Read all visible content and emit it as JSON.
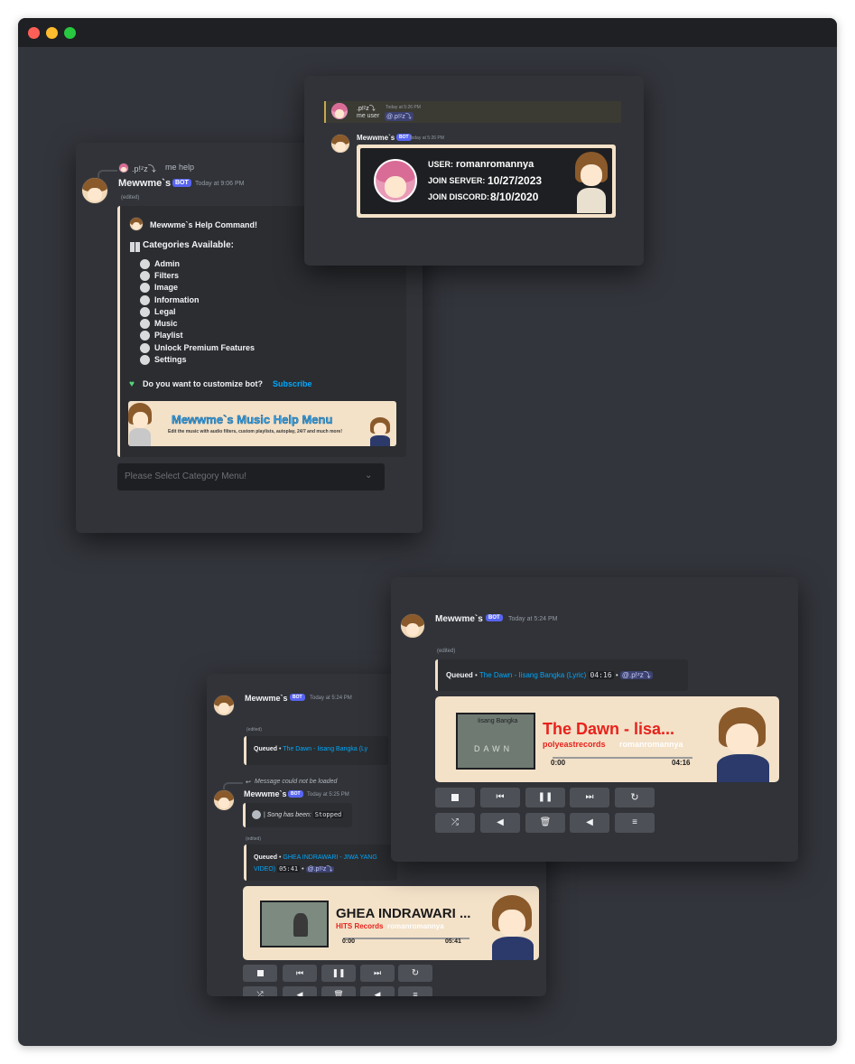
{
  "help_card": {
    "reply": {
      "user": ".p!ᶻz⤵",
      "command": "me help"
    },
    "bot_name": "Mewwme`s",
    "bot_badge": "BOT",
    "timestamp": "Today at 9:06 PM",
    "edited": "(edited)",
    "embed_title": "Mewwme`s Help Command!",
    "categories_heading": "Categories Available:",
    "categories": [
      "Admin",
      "Filters",
      "Image",
      "Information",
      "Legal",
      "Music",
      "Playlist",
      "Unlock Premium Features",
      "Settings"
    ],
    "customize_text": "Do you want to customize bot?",
    "subscribe_link": "Subscribe",
    "banner_title": "Mewwme`s Music Help Menu",
    "banner_subtitle": "Edit the music with audio filters, custom playlists, autoplay, 24/7 and much more!",
    "select_placeholder": "Please Select Category Menu!"
  },
  "user_card": {
    "reply_user": ".p!ᶻz⤵",
    "reply_time": "Today at 5:26 PM",
    "reply_command": "me user",
    "reply_mention": "@.p!ᶻz⤵",
    "bot_name": "Mewwme`s",
    "bot_badge": "BOT",
    "timestamp": "Today at 5:26 PM",
    "user_label": "USER:",
    "user_value": "romanromannya",
    "join_server_label": "JOIN SERVER:",
    "join_server_value": "10/27/2023",
    "join_discord_label": "JOIN DISCORD:",
    "join_discord_value": "8/10/2020"
  },
  "music_card_front": {
    "bot_name": "Mewwme`s",
    "bot_badge": "BOT",
    "timestamp": "Today at 5:24 PM",
    "edited": "(edited)",
    "queued_label": "Queued",
    "queued_track": "The Dawn - Iisang Bangka (Lyric)",
    "queued_duration": "04:16",
    "queued_mention": "@.p!ᶻz⤵",
    "song_title": "The Dawn - lisa...",
    "song_channel": "polyeastrecords",
    "song_requester": "romanromannya",
    "time_start": "0:00",
    "time_end": "04:16",
    "thumb_text_top": "Iisang Bangka",
    "thumb_text_bottom": "DAWN",
    "controls_row1": [
      "stop-icon",
      "previous-icon",
      "pause-icon",
      "next-icon",
      "loop-icon"
    ],
    "controls_row2": [
      "shuffle-icon",
      "volume-down-icon",
      "delete-icon",
      "volume-up-icon",
      "queue-icon"
    ]
  },
  "music_card_back": {
    "bot_name": "Mewwme`s",
    "bot_badge": "BOT",
    "timestamp1": "Today at 5:24 PM",
    "edited1": "(edited)",
    "queued_label": "Queued",
    "queued_track_partial": "The Dawn - Iisang Bangka (Ly",
    "reply_missing": "Message could not be loaded",
    "timestamp2": "Today at 5:25 PM",
    "stopped_text": "Song has been:",
    "stopped_code": "Stopped",
    "edited2": "(edited)",
    "queued2_label": "Queued",
    "queued2_track_line1": "GHEA INDRAWARI - JIWA YANG",
    "queued2_track_line2": "VIDEO)",
    "queued2_duration": "05:41",
    "queued2_mention": "@.p!ᶻz⤵",
    "song_title": "GHEA INDRAWARI ...",
    "song_channel": "HITS Records",
    "song_requester": "romanromannya",
    "time_start": "0:00",
    "time_end": "05:41"
  },
  "colors": {
    "accent_blue": "#00a8fc",
    "bot_badge": "#5865f2",
    "song_red": "#e8221b",
    "embed_border": "#f0e0c8"
  }
}
